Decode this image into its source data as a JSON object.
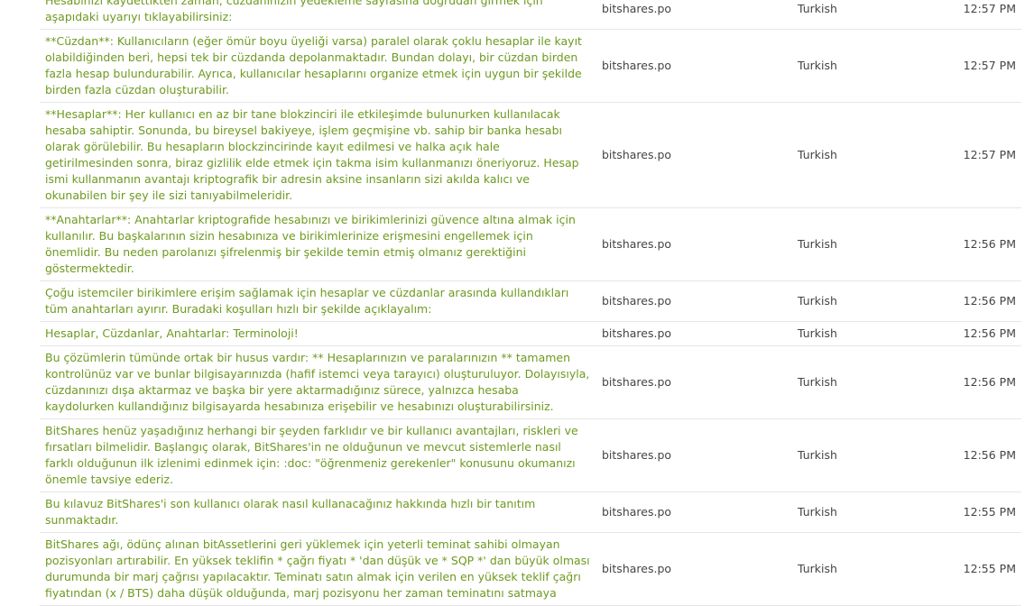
{
  "rows": [
    {
      "text": "Hesabınızı kaydettikten zaman, cüzdanınızın yedekleme sayfasına doğrudan girmek için aşapıdaki uyarıyı tıklayabilirsiniz:",
      "project": "bitshares.po",
      "language": "Turkish",
      "time": "12:57 PM"
    },
    {
      "text": "**Cüzdan**: Kullanıcıların (eğer ömür boyu üyeliği varsa) paralel olarak çoklu hesaplar ile kayıt olabildiğinden beri, hepsi tek bir cüzdanda depolanmaktadır. Bundan dolayı, bir cüzdan birden fazla hesap bulundurabilir. Ayrıca, kullanıcılar hesaplarını organize etmek için uygun bir şekilde birden fazla cüzdan oluşturabilir.",
      "project": "bitshares.po",
      "language": "Turkish",
      "time": "12:57 PM"
    },
    {
      "text": "**Hesaplar**: Her kullanıcı en az bir tane blokzinciri ile etkileşimde bulunurken kullanılacak hesaba sahiptir. Sonunda, bu bireysel bakiyeye, işlem geçmişine vb. sahip bir banka hesabı olarak görülebilir. Bu hesapların blockzincirinde kayıt edilmesi ve halka açık hale getirilmesinden sonra, biraz gizlilik elde etmek için takma isim kullanmanızı öneriyoruz. Hesap ismi kullanmanın avantajı kriptografik bir adresin aksine insanların sizi akılda kalıcı ve okunabilen bir şey ile sizi tanıyabilmeleridir.",
      "project": "bitshares.po",
      "language": "Turkish",
      "time": "12:57 PM"
    },
    {
      "text": "**Anahtarlar**: Anahtarlar kriptografide hesabınızı ve birikimlerinizi güvence altına almak için kullanılır. Bu başkalarının sizin hesabınıza ve birikimlerinize erişmesini engellemek için önemlidir. Bu neden parolanızı şifrelenmiş bir şekilde temin etmiş olmanız gerektiğini göstermektedir.",
      "project": "bitshares.po",
      "language": "Turkish",
      "time": "12:56 PM"
    },
    {
      "text": "Çoğu istemciler birikimlere erişim sağlamak için hesaplar ve cüzdanlar arasında kullandıkları tüm anahtarları ayırır. Buradaki koşulları hızlı bir şekilde açıklayalım:",
      "project": "bitshares.po",
      "language": "Turkish",
      "time": "12:56 PM"
    },
    {
      "text": "Hesaplar, Cüzdanlar, Anahtarlar: Terminoloji!",
      "project": "bitshares.po",
      "language": "Turkish",
      "time": "12:56 PM"
    },
    {
      "text": "Bu çözümlerin tümünde ortak bir husus vardır: ** Hesaplarınızın ve paralarınızın ** tamamen kontrolünüz var ve bunlar bilgisayarınızda (hafif istemci veya tarayıcı) oluşturuluyor. Dolayısıyla, cüzdanınızı dışa aktarmaz ve başka bir yere aktarmadığınız sürece, yalnızca hesaba kaydolurken kullandığınız bilgisayarda hesabınıza erişebilir ve hesabınızı oluşturabilirsiniz.",
      "project": "bitshares.po",
      "language": "Turkish",
      "time": "12:56 PM"
    },
    {
      "text": "BitShares henüz yaşadığınız herhangi bir şeyden farklıdır ve bir kullanıcı avantajları, riskleri ve fırsatları bilmelidir. Başlangıç olarak, BitShares'in ne olduğunun ve mevcut sistemlerle nasıl farklı olduğunun ilk izlenimi edinmek için: :doc: \"öğrenmeniz gerekenler\" konusunu okumanızı önemle tavsiye ederiz.",
      "project": "bitshares.po",
      "language": "Turkish",
      "time": "12:56 PM"
    },
    {
      "text": "Bu kılavuz BitShares'i son kullanıcı olarak nasıl kullanacağınız hakkında hızlı bir tanıtım sunmaktadır.",
      "project": "bitshares.po",
      "language": "Turkish",
      "time": "12:55 PM"
    },
    {
      "text": "BitShares ağı, ödünç alınan bitAssetlerini geri yüklemek için yeterli teminat sahibi olmayan pozisyonları artırabilir. En yüksek teklifin * çağrı fiyatı * 'dan düşük ve * SQP *' dan büyük olması durumunda bir marj çağrısı yapılacaktır. Teminatı satın almak için verilen en yüksek teklif çağrı fiyatından (x / BTS) daha düşük olduğunda, marj pozisyonu her zaman teminatını satmaya",
      "project": "bitshares.po",
      "language": "Turkish",
      "time": "12:55 PM"
    }
  ]
}
